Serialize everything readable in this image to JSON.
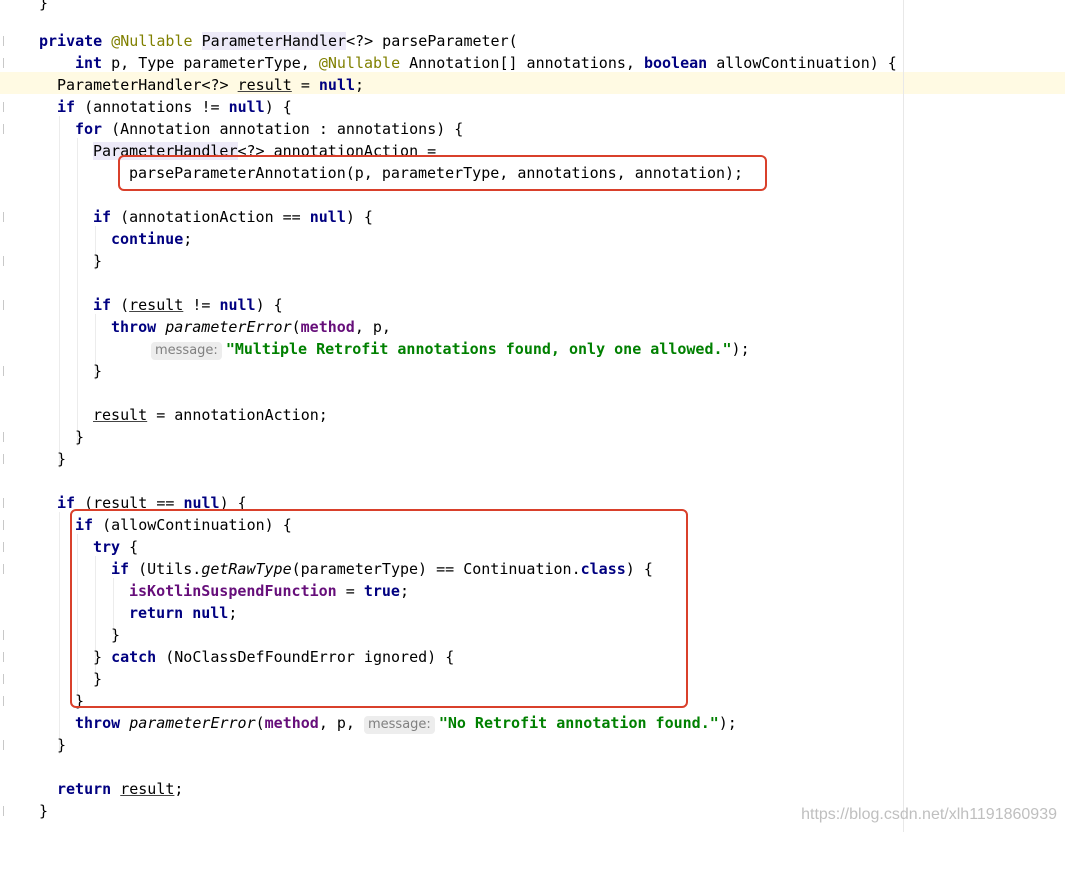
{
  "watermark": "https://blog.csdn.net/xlh1191860939",
  "hint_label": "message:",
  "tokens": {
    "private": "private",
    "nullable": "@Nullable",
    "ParameterHandler": "ParameterHandler",
    "wildcard": "<?>",
    "parseParameter": " parseParameter(",
    "int": "int",
    "p_type": " p, Type parameterType, ",
    "annotation_arr": " Annotation[] annotations, ",
    "boolean": "boolean",
    "allowContinuation_sig": " allowContinuation) {",
    "result": "result",
    "eq": " = ",
    "null": "null",
    "semicolon": ";",
    "if": "if",
    "annotations_neq": " (annotations != ",
    "close_paren_brace": ") {",
    "for": "for",
    "for_body": " (Annotation annotation : annotations) {",
    "annotationAction_decl": " annotationAction =",
    "parse_call": "parseParameterAnnotation(p, parameterType, annotations, annotation);",
    "annotationAction_eq": " (annotationAction == ",
    "continue": "continue",
    "close_brace": "}",
    "paren_open": " (",
    "neq": " != ",
    "throw": "throw",
    "parameterError": "parameterError",
    "lparen": "(",
    "method": "method",
    "comma_p": ", p,",
    "comma_p_space": ", p, ",
    "msg_multiple": "\"Multiple Retrofit annotations found, only one allowed.\"",
    "end_call": ");",
    "annotationAction_assign": " = annotationAction;",
    "eqeq": " == ",
    "allowContinuation_cond": " (allowContinuation) {",
    "try": "try",
    "open_brace_sp": " {",
    "utils_prefix": " (Utils.",
    "getRawType": "getRawType",
    "getRawType_args": "(parameterType) == Continuation.",
    "class": "class",
    "isKotlinSuspendFunction": "isKotlinSuspendFunction",
    "true": "true",
    "return": "return",
    "catch": "catch",
    "catch_body": " (NoClassDefFoundError ignored) {",
    "msg_none": "\"No Retrofit annotation found.\""
  }
}
